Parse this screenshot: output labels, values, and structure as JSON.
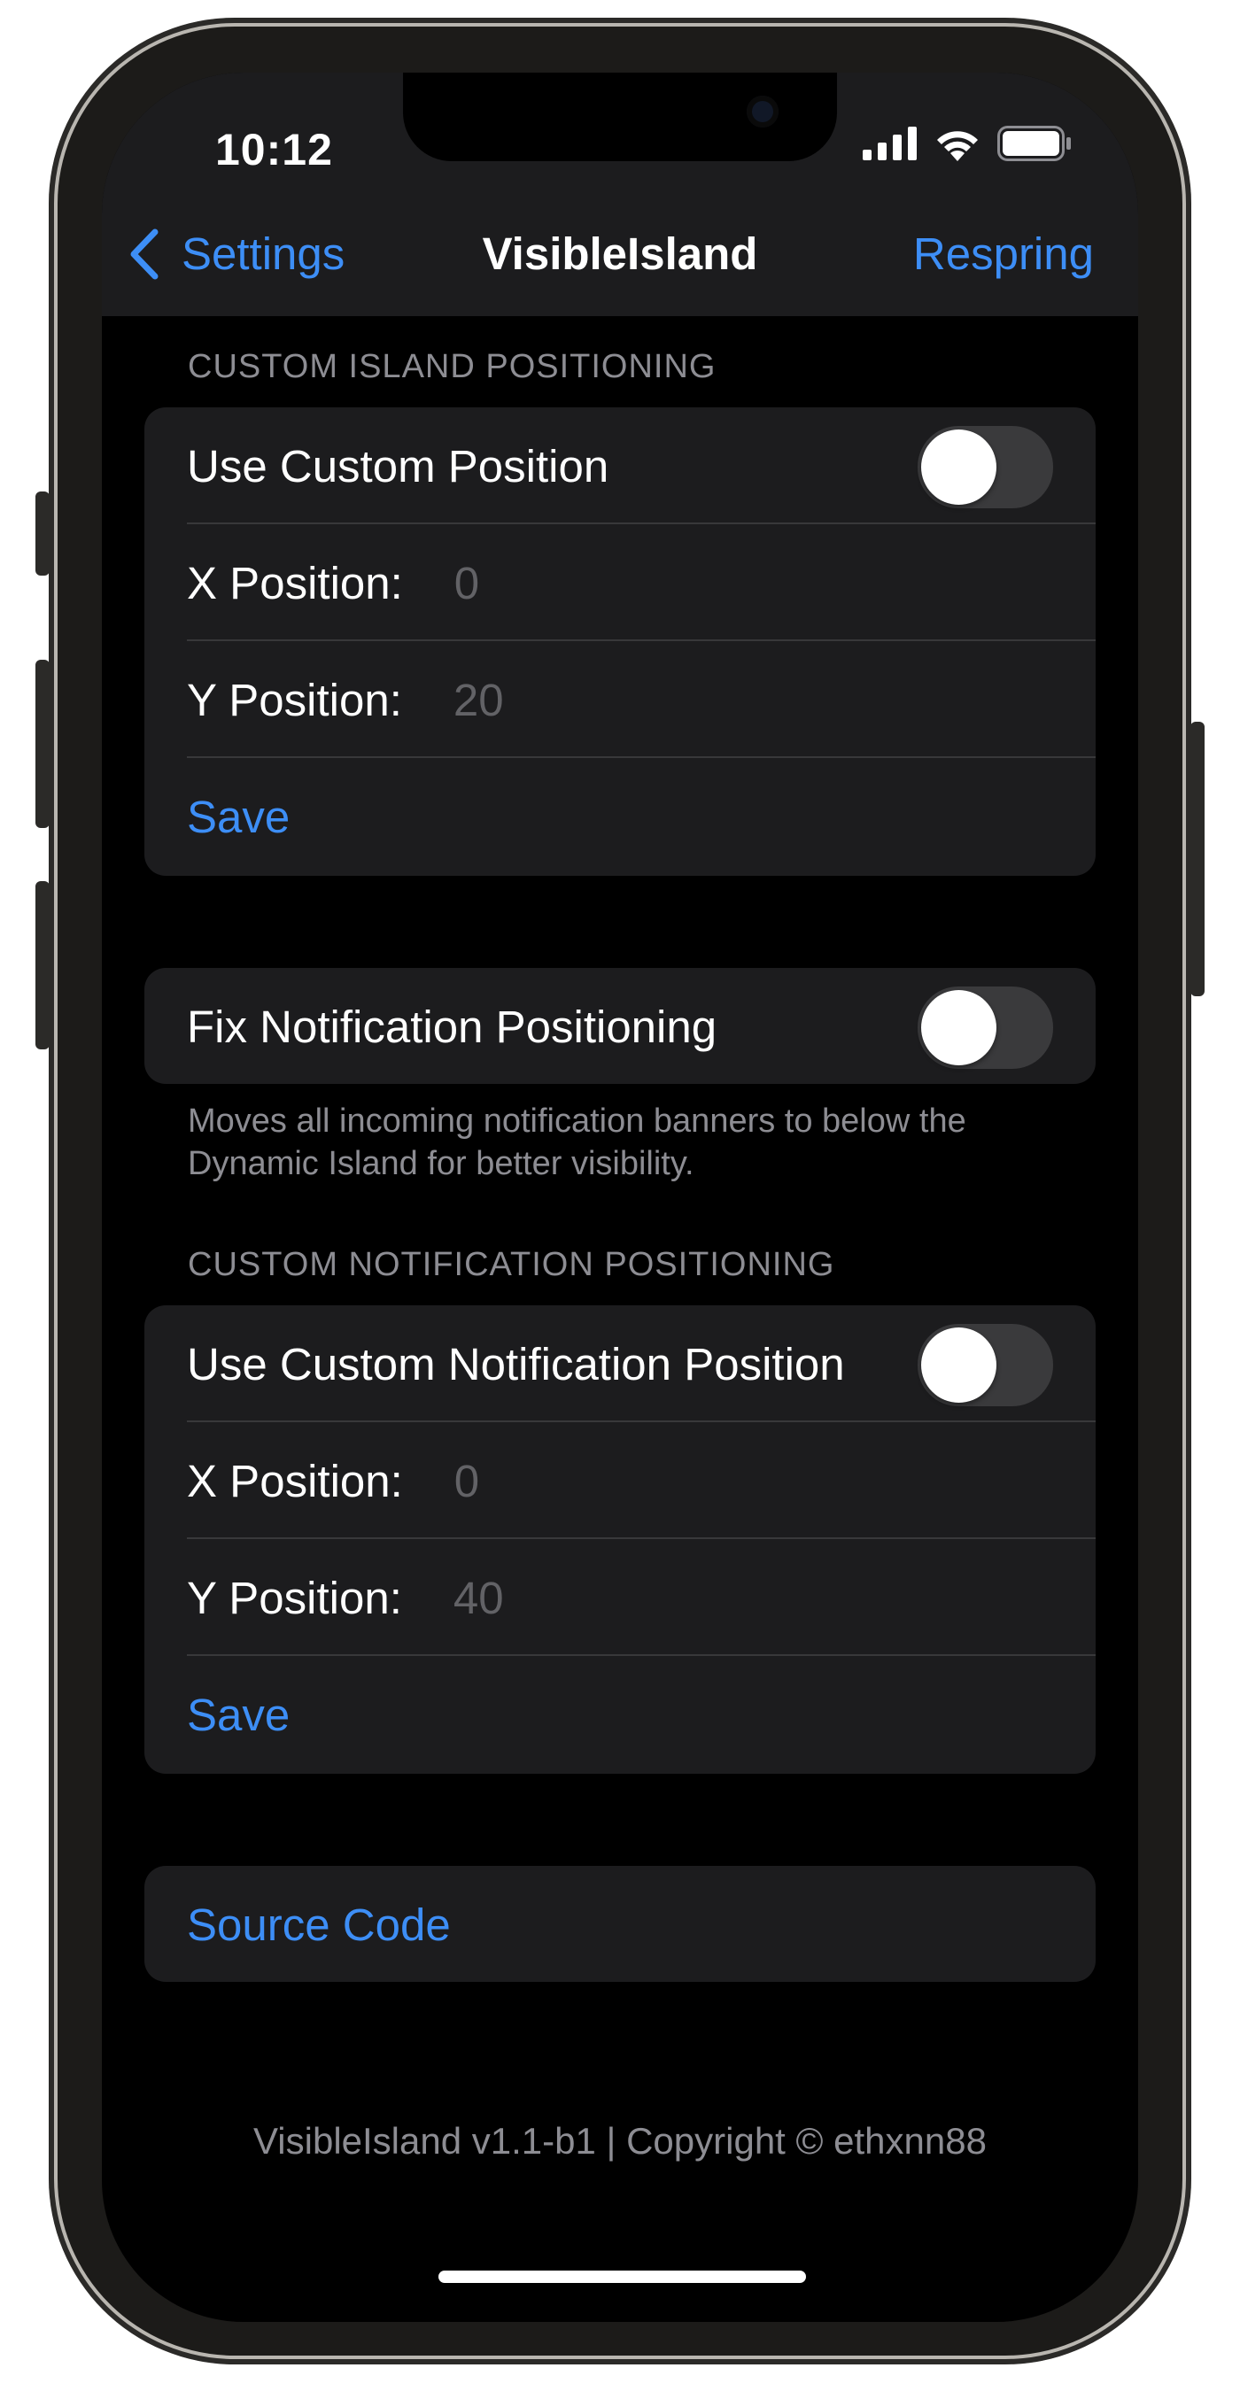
{
  "status_bar": {
    "time": "10:12"
  },
  "nav": {
    "back_label": "Settings",
    "title": "VisibleIsland",
    "right_label": "Respring"
  },
  "island_section": {
    "header": "CUSTOM ISLAND POSITIONING",
    "toggle_label": "Use Custom Position",
    "toggle_on": false,
    "x_label": "X Position:",
    "x_placeholder": "0",
    "y_label": "Y Position:",
    "y_placeholder": "20",
    "save_label": "Save"
  },
  "fix_section": {
    "toggle_label": "Fix Notification Positioning",
    "toggle_on": false,
    "footer": "Moves all incoming notification banners to below the Dynamic Island for better visibility."
  },
  "notification_section": {
    "header": "CUSTOM NOTIFICATION POSITIONING",
    "toggle_label": "Use Custom Notification Position",
    "toggle_on": false,
    "x_label": "X Position:",
    "x_placeholder": "0",
    "y_label": "Y Position:",
    "y_placeholder": "40",
    "save_label": "Save"
  },
  "links": {
    "source_code": "Source Code"
  },
  "footer": {
    "copyright": "VisibleIsland v1.1-b1 | Copyright © ethxnn88"
  },
  "colors": {
    "accent": "#3d8ef6",
    "group_bg": "#1c1c1e",
    "screen_bg": "#000000",
    "secondary_text": "#8d8d93",
    "toggle_off": "#3a3a3c"
  }
}
